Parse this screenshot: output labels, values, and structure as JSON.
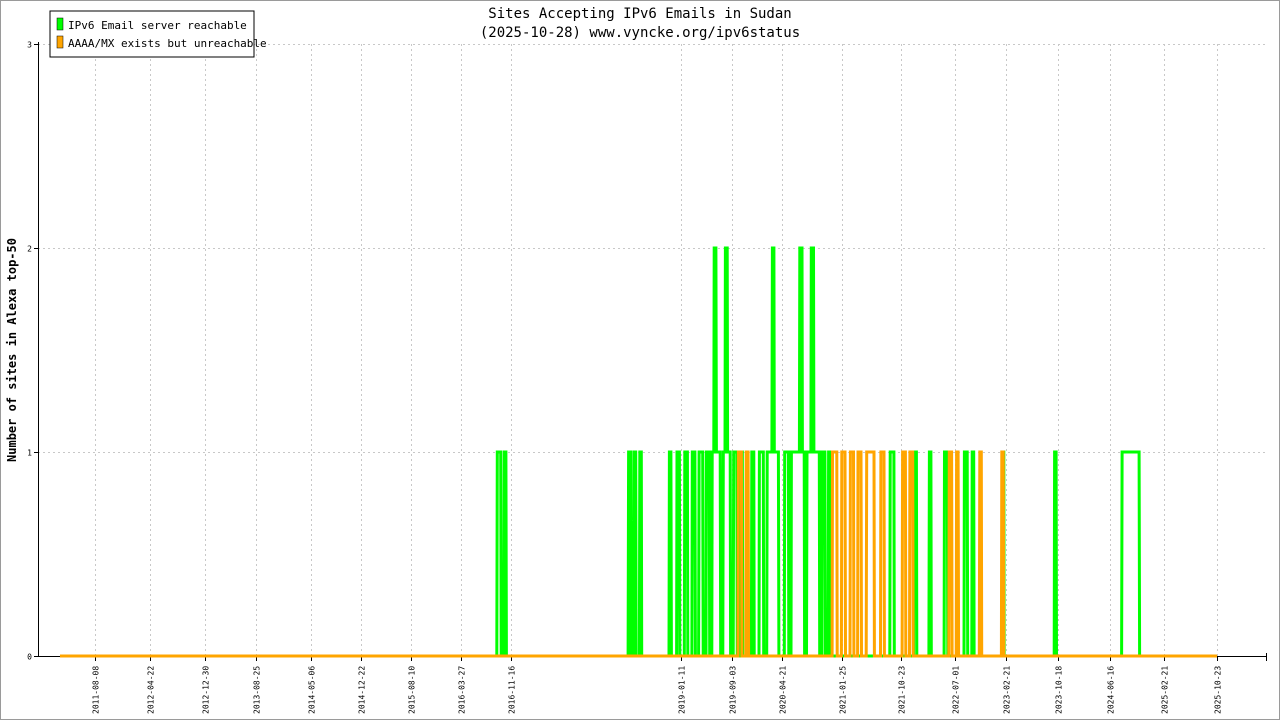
{
  "chart_data": {
    "type": "line",
    "title": "Sites Accepting IPv6 Emails in Sudan",
    "subtitle": "(2025-10-28) www.vyncke.org/ipv6status",
    "xlabel": "",
    "ylabel": "Number of sites in Alexa top-50",
    "ylim": [
      0,
      3
    ],
    "yticks": [
      "0",
      "1",
      "2",
      "3"
    ],
    "grid": true,
    "legend_position": "top-left",
    "x_ticks": [
      "2011-08-08",
      "2012-04-22",
      "2012-12-30",
      "2013-08-25",
      "2014-05-06",
      "2014-12-22",
      "2015-08-10",
      "2016-03-27",
      "2016-11-16",
      "2019-01-11",
      "2019-09-03",
      "2020-04-21",
      "2021-01-25",
      "2021-10-23",
      "2022-07-01",
      "2023-02-21",
      "2023-10-18",
      "2024-06-16",
      "2025-02-21",
      "2025-10-23"
    ],
    "x_range": [
      "2011-03-01",
      "2025-10-23"
    ],
    "series": [
      {
        "name": "IPv6 Email server reachable",
        "color": "#00ff00",
        "points": [
          [
            "2011-03-01",
            0
          ],
          [
            "2016-09-10",
            0
          ],
          [
            "2016-09-12",
            1
          ],
          [
            "2016-09-28",
            1
          ],
          [
            "2016-09-30",
            0
          ],
          [
            "2016-10-12",
            0
          ],
          [
            "2016-10-14",
            1
          ],
          [
            "2016-10-22",
            1
          ],
          [
            "2016-10-24",
            0
          ],
          [
            "2018-05-10",
            0
          ],
          [
            "2018-05-12",
            1
          ],
          [
            "2018-05-22",
            1
          ],
          [
            "2018-05-24",
            0
          ],
          [
            "2018-06-04",
            0
          ],
          [
            "2018-06-06",
            1
          ],
          [
            "2018-06-14",
            1
          ],
          [
            "2018-06-16",
            0
          ],
          [
            "2018-07-01",
            0
          ],
          [
            "2018-07-03",
            1
          ],
          [
            "2018-07-10",
            1
          ],
          [
            "2018-07-12",
            0
          ],
          [
            "2018-11-15",
            0
          ],
          [
            "2018-11-17",
            1
          ],
          [
            "2018-11-24",
            1
          ],
          [
            "2018-11-26",
            0
          ],
          [
            "2018-12-20",
            0
          ],
          [
            "2018-12-22",
            1
          ],
          [
            "2019-01-02",
            1
          ],
          [
            "2019-01-04",
            0
          ],
          [
            "2019-01-25",
            0
          ],
          [
            "2019-01-27",
            1
          ],
          [
            "2019-02-08",
            1
          ],
          [
            "2019-02-10",
            0
          ],
          [
            "2019-03-01",
            0
          ],
          [
            "2019-03-03",
            1
          ],
          [
            "2019-03-15",
            1
          ],
          [
            "2019-03-17",
            0
          ],
          [
            "2019-04-01",
            0
          ],
          [
            "2019-04-03",
            1
          ],
          [
            "2019-04-20",
            1
          ],
          [
            "2019-04-22",
            0
          ],
          [
            "2019-05-05",
            0
          ],
          [
            "2019-05-07",
            1
          ],
          [
            "2019-05-20",
            1
          ],
          [
            "2019-05-22",
            0
          ],
          [
            "2019-06-01",
            0
          ],
          [
            "2019-06-03",
            1
          ],
          [
            "2019-06-10",
            1
          ],
          [
            "2019-06-12",
            2
          ],
          [
            "2019-06-20",
            2
          ],
          [
            "2019-06-22",
            1
          ],
          [
            "2019-07-10",
            1
          ],
          [
            "2019-07-12",
            0
          ],
          [
            "2019-07-22",
            0
          ],
          [
            "2019-07-24",
            1
          ],
          [
            "2019-08-01",
            1
          ],
          [
            "2019-08-03",
            2
          ],
          [
            "2019-08-11",
            2
          ],
          [
            "2019-08-13",
            1
          ],
          [
            "2019-08-25",
            1
          ],
          [
            "2019-08-27",
            0
          ],
          [
            "2019-09-08",
            0
          ],
          [
            "2019-09-10",
            1
          ],
          [
            "2019-09-25",
            1
          ],
          [
            "2019-09-27",
            0
          ],
          [
            "2019-10-10",
            0
          ],
          [
            "2019-10-12",
            1
          ],
          [
            "2019-10-20",
            1
          ],
          [
            "2019-10-22",
            0
          ],
          [
            "2019-12-01",
            0
          ],
          [
            "2019-12-03",
            1
          ],
          [
            "2019-12-12",
            1
          ],
          [
            "2019-12-14",
            0
          ],
          [
            "2020-01-05",
            0
          ],
          [
            "2020-01-07",
            1
          ],
          [
            "2020-01-25",
            1
          ],
          [
            "2020-01-27",
            0
          ],
          [
            "2020-02-10",
            0
          ],
          [
            "2020-02-12",
            1
          ],
          [
            "2020-03-05",
            1
          ],
          [
            "2020-03-07",
            2
          ],
          [
            "2020-03-14",
            2
          ],
          [
            "2020-03-16",
            1
          ],
          [
            "2020-04-04",
            1
          ],
          [
            "2020-04-06",
            0
          ],
          [
            "2020-05-01",
            0
          ],
          [
            "2020-05-03",
            1
          ],
          [
            "2020-05-20",
            1
          ],
          [
            "2020-05-22",
            0
          ],
          [
            "2020-06-01",
            0
          ],
          [
            "2020-06-03",
            1
          ],
          [
            "2020-07-10",
            1
          ],
          [
            "2020-07-12",
            2
          ],
          [
            "2020-07-22",
            2
          ],
          [
            "2020-07-24",
            1
          ],
          [
            "2020-08-01",
            1
          ],
          [
            "2020-08-03",
            0
          ],
          [
            "2020-08-12",
            0
          ],
          [
            "2020-08-14",
            1
          ],
          [
            "2020-09-01",
            1
          ],
          [
            "2020-09-03",
            2
          ],
          [
            "2020-09-13",
            2
          ],
          [
            "2020-09-15",
            1
          ],
          [
            "2020-10-10",
            1
          ],
          [
            "2020-10-12",
            0
          ],
          [
            "2020-10-22",
            0
          ],
          [
            "2020-10-24",
            1
          ],
          [
            "2020-11-05",
            1
          ],
          [
            "2020-11-07",
            0
          ],
          [
            "2020-11-20",
            0
          ],
          [
            "2020-11-22",
            1
          ],
          [
            "2020-12-01",
            1
          ],
          [
            "2020-12-03",
            0
          ],
          [
            "2021-09-01",
            0
          ],
          [
            "2021-09-03",
            1
          ],
          [
            "2021-09-20",
            1
          ],
          [
            "2021-09-22",
            0
          ],
          [
            "2021-12-20",
            0
          ],
          [
            "2021-12-22",
            1
          ],
          [
            "2022-01-02",
            1
          ],
          [
            "2022-01-04",
            0
          ],
          [
            "2022-03-01",
            0
          ],
          [
            "2022-03-03",
            1
          ],
          [
            "2022-03-10",
            1
          ],
          [
            "2022-03-12",
            0
          ],
          [
            "2022-05-10",
            0
          ],
          [
            "2022-05-12",
            1
          ],
          [
            "2022-05-25",
            1
          ],
          [
            "2022-05-27",
            0
          ],
          [
            "2022-08-10",
            0
          ],
          [
            "2022-08-12",
            1
          ],
          [
            "2022-08-25",
            1
          ],
          [
            "2022-08-27",
            0
          ],
          [
            "2022-09-15",
            0
          ],
          [
            "2022-09-17",
            1
          ],
          [
            "2022-09-24",
            1
          ],
          [
            "2022-09-26",
            0
          ],
          [
            "2023-02-01",
            0
          ],
          [
            "2023-02-03",
            1
          ],
          [
            "2023-02-10",
            1
          ],
          [
            "2023-02-12",
            0
          ],
          [
            "2023-10-01",
            0
          ],
          [
            "2023-10-03",
            1
          ],
          [
            "2023-10-10",
            1
          ],
          [
            "2023-10-12",
            0
          ],
          [
            "2024-08-08",
            0
          ],
          [
            "2024-08-10",
            1
          ],
          [
            "2024-10-28",
            1
          ],
          [
            "2024-10-30",
            0
          ],
          [
            "2025-10-23",
            0
          ]
        ]
      },
      {
        "name": "AAAA/MX exists but unreachable",
        "color": "#ffa500",
        "points": [
          [
            "2011-03-01",
            0
          ],
          [
            "2019-09-30",
            0
          ],
          [
            "2019-10-02",
            1
          ],
          [
            "2019-10-16",
            1
          ],
          [
            "2019-10-18",
            0
          ],
          [
            "2019-11-05",
            0
          ],
          [
            "2019-11-07",
            1
          ],
          [
            "2019-11-16",
            1
          ],
          [
            "2019-11-18",
            0
          ],
          [
            "2020-12-08",
            0
          ],
          [
            "2020-12-10",
            1
          ],
          [
            "2020-12-30",
            1
          ],
          [
            "2021-01-01",
            0
          ],
          [
            "2021-01-20",
            0
          ],
          [
            "2021-01-22",
            1
          ],
          [
            "2021-02-06",
            1
          ],
          [
            "2021-02-08",
            0
          ],
          [
            "2021-03-01",
            0
          ],
          [
            "2021-03-03",
            1
          ],
          [
            "2021-03-17",
            1
          ],
          [
            "2021-03-19",
            0
          ],
          [
            "2021-04-05",
            0
          ],
          [
            "2021-04-07",
            1
          ],
          [
            "2021-04-21",
            1
          ],
          [
            "2021-04-23",
            0
          ],
          [
            "2021-05-15",
            0
          ],
          [
            "2021-05-17",
            1
          ],
          [
            "2021-06-20",
            1
          ],
          [
            "2021-06-22",
            0
          ],
          [
            "2021-07-20",
            0
          ],
          [
            "2021-07-22",
            1
          ],
          [
            "2021-08-05",
            1
          ],
          [
            "2021-08-07",
            0
          ],
          [
            "2021-10-28",
            0
          ],
          [
            "2021-10-30",
            1
          ],
          [
            "2021-11-12",
            1
          ],
          [
            "2021-11-14",
            0
          ],
          [
            "2021-12-01",
            0
          ],
          [
            "2021-12-03",
            1
          ],
          [
            "2021-12-16",
            1
          ],
          [
            "2021-12-18",
            0
          ],
          [
            "2022-06-01",
            0
          ],
          [
            "2022-06-03",
            1
          ],
          [
            "2022-06-14",
            1
          ],
          [
            "2022-06-16",
            0
          ],
          [
            "2022-07-05",
            0
          ],
          [
            "2022-07-07",
            1
          ],
          [
            "2022-07-14",
            1
          ],
          [
            "2022-07-16",
            0
          ],
          [
            "2022-10-20",
            0
          ],
          [
            "2022-10-22",
            1
          ],
          [
            "2022-10-29",
            1
          ],
          [
            "2022-10-31",
            0
          ],
          [
            "2023-01-30",
            0
          ],
          [
            "2023-02-01",
            1
          ],
          [
            "2023-02-08",
            1
          ],
          [
            "2023-02-10",
            0
          ],
          [
            "2025-10-23",
            0
          ]
        ]
      }
    ]
  }
}
